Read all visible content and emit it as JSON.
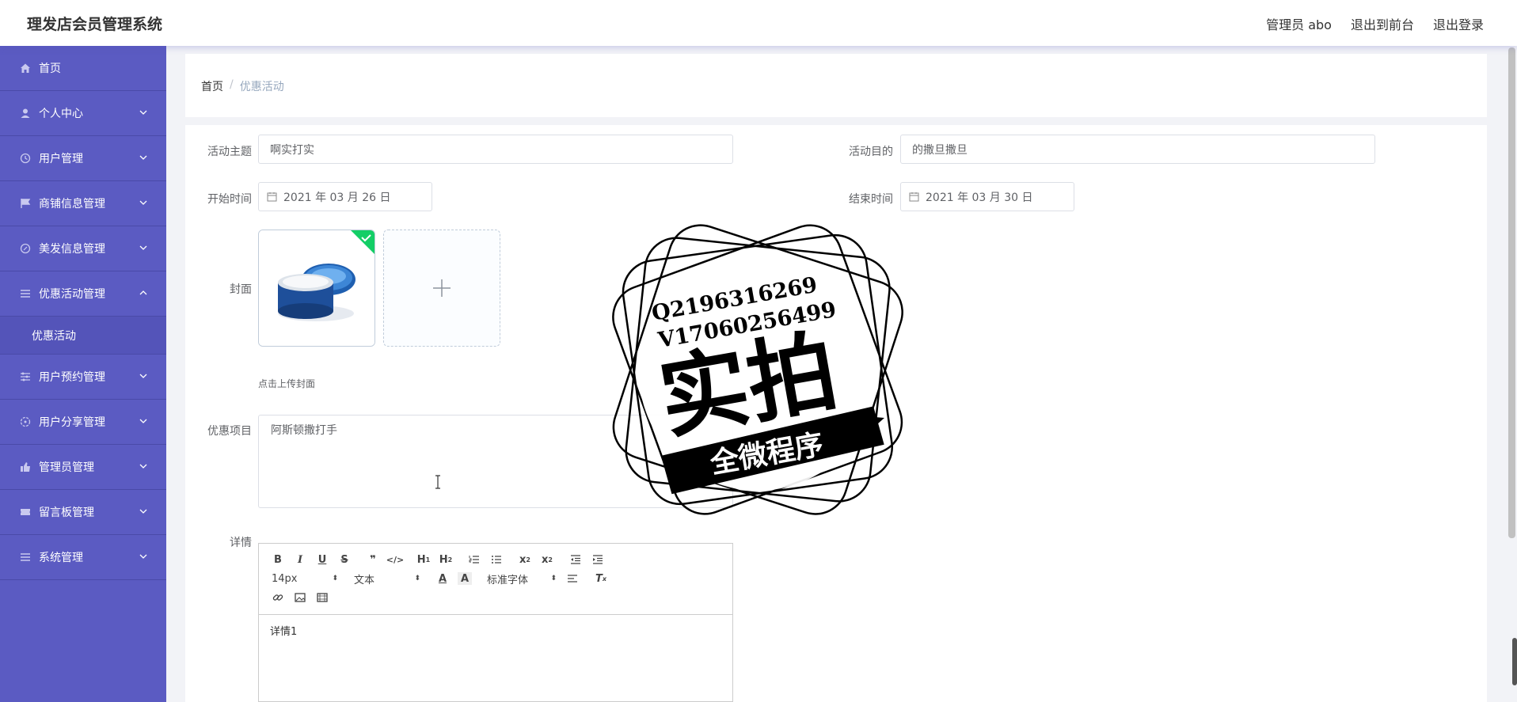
{
  "header": {
    "title": "理发店会员管理系统",
    "links": [
      "管理员 abo",
      "退出到前台",
      "退出登录"
    ]
  },
  "sidebar": {
    "items": [
      {
        "label": "首页",
        "icon": "home-icon",
        "has_children": false
      },
      {
        "label": "个人中心",
        "icon": "user-icon",
        "has_children": true
      },
      {
        "label": "用户管理",
        "icon": "clock-icon",
        "has_children": true
      },
      {
        "label": "商铺信息管理",
        "icon": "flag-icon",
        "has_children": true
      },
      {
        "label": "美发信息管理",
        "icon": "compass-icon",
        "has_children": true
      },
      {
        "label": "优惠活动管理",
        "icon": "menu-icon",
        "has_children": true,
        "expanded": true
      },
      {
        "label": "用户预约管理",
        "icon": "sliders-icon",
        "has_children": true
      },
      {
        "label": "用户分享管理",
        "icon": "target-icon",
        "has_children": true
      },
      {
        "label": "管理员管理",
        "icon": "thumb-icon",
        "has_children": true
      },
      {
        "label": "留言板管理",
        "icon": "ticket-icon",
        "has_children": true
      },
      {
        "label": "系统管理",
        "icon": "list-icon",
        "has_children": true
      }
    ],
    "sub_item": "优惠活动"
  },
  "breadcrumb": {
    "home": "首页",
    "separator": "/",
    "current": "优惠活动"
  },
  "form": {
    "theme_label": "活动主题",
    "theme_value": "啊实打实",
    "purpose_label": "活动目的",
    "purpose_value": "的撒旦撒旦",
    "start_label": "开始时间",
    "start_value": "2021 年 03 月 26 日",
    "end_label": "结束时间",
    "end_value": "2021 年 03 月 30 日",
    "cover_label": "封面",
    "cover_tip": "点击上传封面",
    "items_label": "优惠项目",
    "items_value": "阿斯顿撒打手",
    "detail_label": "详情"
  },
  "editor": {
    "font_size": "14px",
    "block_type": "文本",
    "font_family": "标准字体",
    "content": "详情1"
  },
  "watermark": {
    "line1": "Q2196316269",
    "line2": "V17060256499",
    "big": "实拍",
    "ribbon": "全微程序"
  },
  "colors": {
    "sidebar": "#5b5bc2",
    "accent": "#13ce66"
  }
}
